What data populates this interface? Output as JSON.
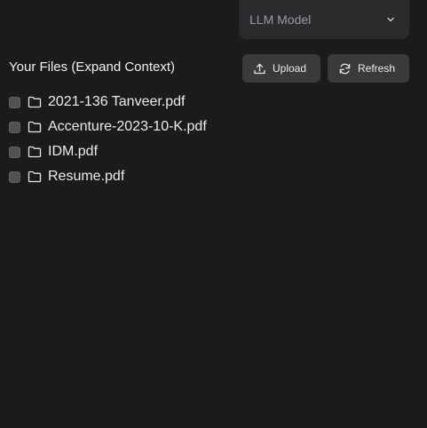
{
  "model_select": {
    "label": "LLM Model",
    "icon": "chevron-down-icon"
  },
  "files": {
    "title": "Your Files (Expand Context)",
    "upload_label": "Upload",
    "refresh_label": "Refresh",
    "items": [
      {
        "name": "2021-136 Tanveer.pdf",
        "checked": false
      },
      {
        "name": "Accenture-2023-10-K.pdf",
        "checked": false
      },
      {
        "name": "IDM.pdf",
        "checked": false
      },
      {
        "name": "Resume.pdf",
        "checked": false
      }
    ]
  },
  "colors": {
    "background": "#1b1b1c",
    "button": "#3a3a3d",
    "select": "#2b2b2e"
  }
}
